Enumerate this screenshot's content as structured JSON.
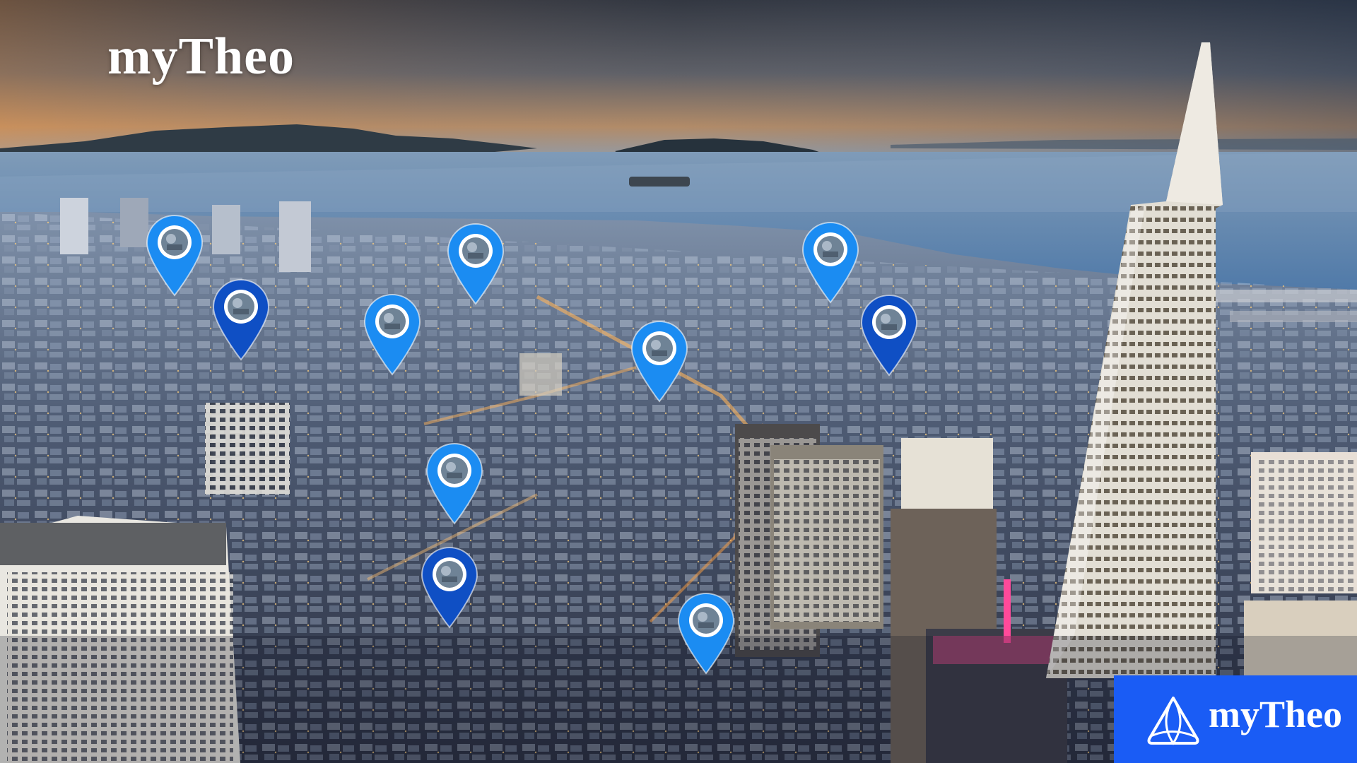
{
  "brand": {
    "title": "myTheo",
    "badge_text": "myTheo",
    "badge_color": "#1a5cf5"
  },
  "pins": [
    {
      "name": "location-pin-1",
      "color": "#1b8cf2"
    },
    {
      "name": "location-pin-2",
      "color": "#0f4fc4"
    },
    {
      "name": "location-pin-3",
      "color": "#1b8cf2"
    },
    {
      "name": "location-pin-4",
      "color": "#1b8cf2"
    },
    {
      "name": "location-pin-5",
      "color": "#1b8cf2"
    },
    {
      "name": "location-pin-6",
      "color": "#0f4fc4"
    },
    {
      "name": "location-pin-7",
      "color": "#1b8cf2"
    },
    {
      "name": "location-pin-8",
      "color": "#1b8cf2"
    },
    {
      "name": "location-pin-9",
      "color": "#0f4fc4"
    },
    {
      "name": "location-pin-10",
      "color": "#1b8cf2"
    }
  ]
}
